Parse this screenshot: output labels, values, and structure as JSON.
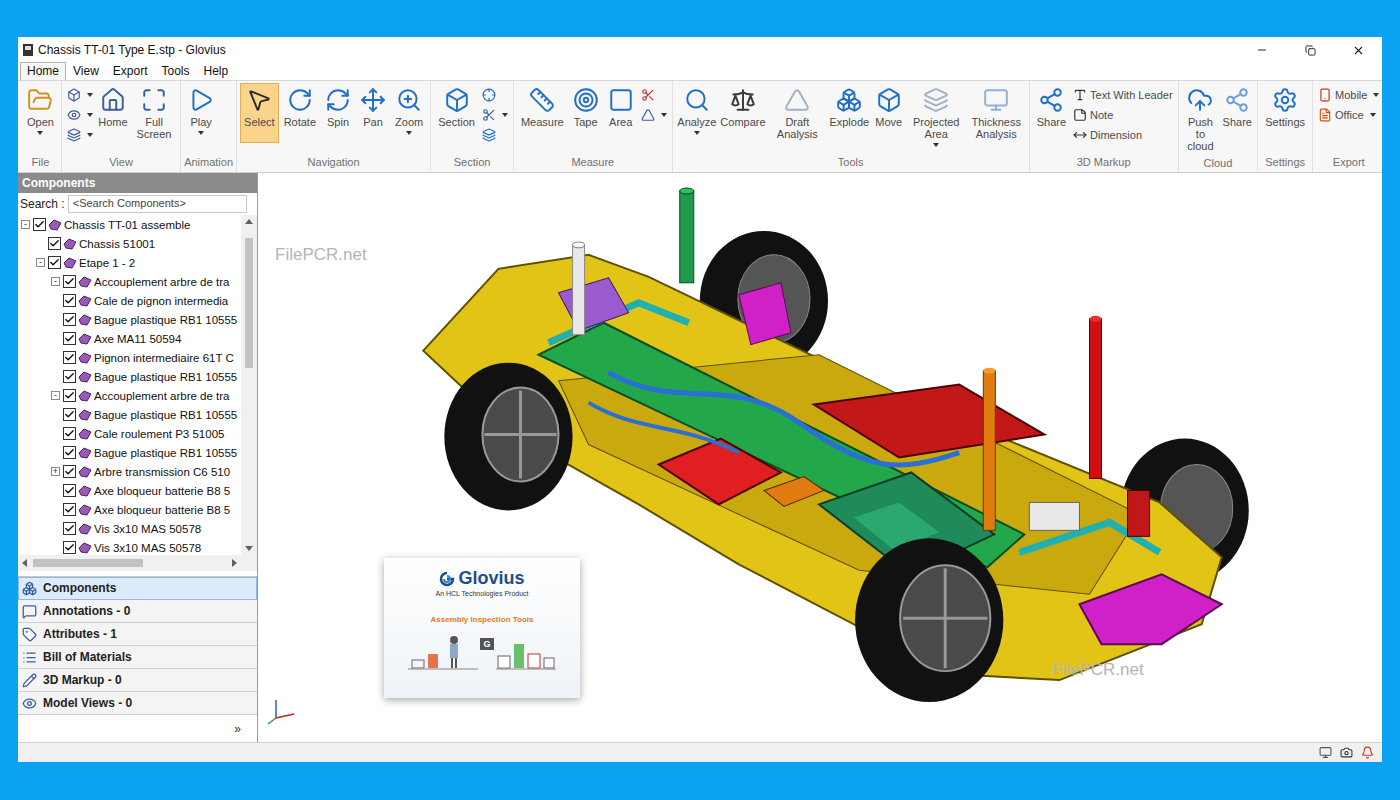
{
  "window": {
    "title": "Chassis TT-01 Type E.stp - Glovius"
  },
  "menu": [
    {
      "label": "Home",
      "selected": true
    },
    {
      "label": "View",
      "selected": false
    },
    {
      "label": "Export",
      "selected": false
    },
    {
      "label": "Tools",
      "selected": false
    },
    {
      "label": "Help",
      "selected": false
    }
  ],
  "ribbon": [
    {
      "label": "File",
      "buttons": [
        {
          "kind": "large",
          "label": "Open",
          "menu": true,
          "selected": false
        }
      ]
    },
    {
      "label": "View",
      "buttons": [
        {
          "kind": "icon",
          "menu": true,
          "selected": false
        },
        {
          "kind": "icon",
          "menu": true,
          "selected": false
        },
        {
          "kind": "icon",
          "menu": true,
          "selected": false
        },
        {
          "kind": "large",
          "label": "Home",
          "menu": false,
          "selected": false
        },
        {
          "kind": "large",
          "label": "Full Screen",
          "menu": false,
          "selected": false
        }
      ]
    },
    {
      "label": "Animation",
      "buttons": [
        {
          "kind": "large",
          "label": "Play",
          "menu": true,
          "selected": false
        }
      ]
    },
    {
      "label": "Navigation",
      "buttons": [
        {
          "kind": "large",
          "label": "Select",
          "menu": false,
          "selected": true
        },
        {
          "kind": "large",
          "label": "Rotate",
          "menu": false,
          "selected": false
        },
        {
          "kind": "large",
          "label": "Spin",
          "menu": false,
          "selected": false
        },
        {
          "kind": "large",
          "label": "Pan",
          "menu": false,
          "selected": false
        },
        {
          "kind": "large",
          "label": "Zoom",
          "menu": true,
          "selected": false
        }
      ]
    },
    {
      "label": "Section",
      "buttons": [
        {
          "kind": "large",
          "label": "Section",
          "menu": false,
          "selected": false
        },
        {
          "kind": "icon",
          "menu": false,
          "selected": false
        },
        {
          "kind": "icon",
          "menu": true,
          "selected": false
        },
        {
          "kind": "icon",
          "menu": false,
          "selected": false
        }
      ]
    },
    {
      "label": "Measure",
      "buttons": [
        {
          "kind": "large",
          "label": "Measure",
          "menu": false,
          "selected": false
        },
        {
          "kind": "large",
          "label": "Tape",
          "menu": false,
          "selected": false
        },
        {
          "kind": "large",
          "label": "Area",
          "menu": false,
          "selected": false
        },
        {
          "kind": "icon",
          "menu": false,
          "selected": false
        },
        {
          "kind": "icon",
          "menu": true,
          "selected": false
        }
      ]
    },
    {
      "label": "Tools",
      "buttons": [
        {
          "kind": "large",
          "label": "Analyze",
          "menu": true,
          "selected": false
        },
        {
          "kind": "large",
          "label": "Compare",
          "menu": false,
          "selected": false
        },
        {
          "kind": "large",
          "label": "Draft Analysis",
          "menu": false,
          "selected": false
        },
        {
          "kind": "large",
          "label": "Explode",
          "menu": false,
          "selected": false
        },
        {
          "kind": "large",
          "label": "Move",
          "menu": false,
          "selected": false
        },
        {
          "kind": "large",
          "label": "Projected Area",
          "menu": true,
          "selected": false
        },
        {
          "kind": "large",
          "label": "Thickness Analysis",
          "menu": false,
          "selected": false
        }
      ]
    },
    {
      "label": "3D Markup",
      "buttons": [
        {
          "kind": "large",
          "label": "Share",
          "menu": false,
          "selected": false
        },
        {
          "kind": "small",
          "label": "Text With Leader",
          "menu": false,
          "selected": false
        },
        {
          "kind": "small",
          "label": "Note",
          "menu": false,
          "selected": false
        },
        {
          "kind": "small",
          "label": "Dimension",
          "menu": false,
          "selected": false
        }
      ]
    },
    {
      "label": "Cloud",
      "buttons": [
        {
          "kind": "large",
          "label": "Push to cloud",
          "menu": false,
          "selected": false
        },
        {
          "kind": "large",
          "label": "Share",
          "menu": false,
          "selected": false
        }
      ]
    },
    {
      "label": "Settings",
      "buttons": [
        {
          "kind": "large",
          "label": "Settings",
          "menu": false,
          "selected": false
        }
      ]
    },
    {
      "label": "Export",
      "buttons": [
        {
          "kind": "small",
          "label": "Mobile",
          "menu": true,
          "selected": false
        },
        {
          "kind": "small",
          "label": "Office",
          "menu": true,
          "selected": false
        }
      ]
    }
  ],
  "components_panel": {
    "title": "Components",
    "search_label": "Search :",
    "search_placeholder": "<Search Components>",
    "tree": [
      {
        "label": "Chassis TT-01 assemble",
        "depth": 0,
        "toggle": "-",
        "checked": true
      },
      {
        "label": "Chassis 51001",
        "depth": 1,
        "toggle": null,
        "checked": true
      },
      {
        "label": "Etape 1 - 2",
        "depth": 1,
        "toggle": "-",
        "checked": true
      },
      {
        "label": "Accouplement arbre de tra",
        "depth": 2,
        "toggle": "-",
        "checked": true
      },
      {
        "label": "Cale de pignon intermedia",
        "depth": 2,
        "toggle": null,
        "checked": true
      },
      {
        "label": "Bague plastique RB1 10555",
        "depth": 2,
        "toggle": null,
        "checked": true
      },
      {
        "label": "Axe MA11 50594",
        "depth": 2,
        "toggle": null,
        "checked": true
      },
      {
        "label": "Pignon intermediaire 61T C",
        "depth": 2,
        "toggle": null,
        "checked": true
      },
      {
        "label": "Bague plastique RB1 10555",
        "depth": 2,
        "toggle": null,
        "checked": true
      },
      {
        "label": "Accouplement arbre de tra",
        "depth": 2,
        "toggle": "-",
        "checked": true
      },
      {
        "label": "Bague plastique RB1 10555",
        "depth": 2,
        "toggle": null,
        "checked": true
      },
      {
        "label": "Cale roulement P3 51005",
        "depth": 2,
        "toggle": null,
        "checked": true
      },
      {
        "label": "Bague plastique RB1 10555",
        "depth": 2,
        "toggle": null,
        "checked": true
      },
      {
        "label": "Arbre transmission C6 510",
        "depth": 2,
        "toggle": "+",
        "checked": true
      },
      {
        "label": "Axe bloqueur batterie B8 5",
        "depth": 2,
        "toggle": null,
        "checked": true
      },
      {
        "label": "Axe bloqueur batterie B8 5",
        "depth": 2,
        "toggle": null,
        "checked": true
      },
      {
        "label": "Vis 3x10 MAS 50578",
        "depth": 2,
        "toggle": null,
        "checked": true
      },
      {
        "label": "Vis 3x10 MAS 50578",
        "depth": 2,
        "toggle": null,
        "checked": true
      }
    ]
  },
  "panel_tabs": [
    {
      "label": "Components",
      "selected": true
    },
    {
      "label": "Annotations - 0",
      "selected": false
    },
    {
      "label": "Attributes - 1",
      "selected": false
    },
    {
      "label": "Bill of Materials",
      "selected": false
    },
    {
      "label": "3D Markup - 0",
      "selected": false
    },
    {
      "label": "Model Views - 0",
      "selected": false
    }
  ],
  "panel_footer": "»",
  "viewport": {
    "watermarks": [
      "FilePCR.net",
      "FilePCR.net"
    ],
    "splash": {
      "logo": "Glovius",
      "tagline": "An HCL Technologies Product",
      "subtitle": "Assembly Inspection Tools",
      "badge": "G"
    }
  }
}
